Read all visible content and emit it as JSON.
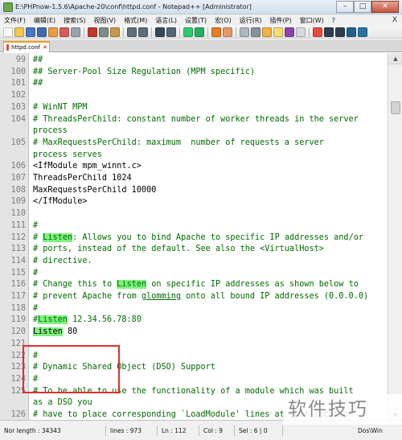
{
  "window": {
    "title": "E:\\PHPnow-1.5.6\\Apache-20\\conf\\httpd.conf - Notepad++ [Administrator]",
    "minimize": "–",
    "maximize": "□",
    "close": "✕"
  },
  "menu": {
    "items": [
      "文件(F)",
      "编辑(E)",
      "搜索(S)",
      "视图(V)",
      "格式(M)",
      "语言(L)",
      "设置(T)",
      "宏(O)",
      "运行(R)",
      "插件(P)",
      "窗口(W)",
      "?"
    ],
    "close_label": "X"
  },
  "tab": {
    "label": "httpd.conf",
    "close": "✕"
  },
  "lines": [
    {
      "n": "99",
      "t": "##"
    },
    {
      "n": "100",
      "t": "## Server-Pool Size Regulation (MPM specific)"
    },
    {
      "n": "101",
      "t": "##"
    },
    {
      "n": "102",
      "t": ""
    },
    {
      "n": "103",
      "t": "# WinNT MPM"
    },
    {
      "n": "104",
      "t": "# ThreadsPerChild: constant number of worker threads in the server"
    },
    {
      "n": "",
      "t": "process"
    },
    {
      "n": "105",
      "t": "# MaxRequestsPerChild: maximum  number of requests a server"
    },
    {
      "n": "",
      "t": "process serves"
    },
    {
      "n": "106",
      "t": "<IfModule mpm_winnt.c>"
    },
    {
      "n": "107",
      "t": "ThreadsPerChild 1024"
    },
    {
      "n": "108",
      "t": "MaxRequestsPerChild 10000"
    },
    {
      "n": "109",
      "t": "</IfModule>"
    },
    {
      "n": "110",
      "t": ""
    },
    {
      "n": "111",
      "t": "#"
    },
    {
      "n": "112",
      "t": "# Listen: Allows you to bind Apache to specific IP addresses and/or"
    },
    {
      "n": "113",
      "t": "# ports, instead of the default. See also the <VirtualHost>"
    },
    {
      "n": "114",
      "t": "# directive."
    },
    {
      "n": "115",
      "t": "#"
    },
    {
      "n": "116",
      "t": "# Change this to Listen on specific IP addresses as shown below to"
    },
    {
      "n": "117",
      "t": "# prevent Apache from glomming onto all bound IP addresses (0.0.0.0)"
    },
    {
      "n": "118",
      "t": "#"
    },
    {
      "n": "119",
      "t": "#Listen 12.34.56.78:80"
    },
    {
      "n": "120",
      "t": "Listen 80"
    },
    {
      "n": "121",
      "t": ""
    },
    {
      "n": "122",
      "t": "#"
    },
    {
      "n": "123",
      "t": "# Dynamic Shared Object (DSO) Support"
    },
    {
      "n": "124",
      "t": "#"
    },
    {
      "n": "125",
      "t": "# To be able to use the functionality of a module which was built"
    },
    {
      "n": "",
      "t": "as a DSO you"
    },
    {
      "n": "126",
      "t": "# have to place corresponding `LoadModule' lines at this location"
    }
  ],
  "highlight_word": "Listen",
  "highlight_color": "#7df27d",
  "comment_color": "#006a00",
  "annotation_color": "#e12f2f",
  "status": {
    "length": "Nor length : 34343",
    "lines": "lines : 973",
    "ln": "Ln : 112",
    "col": "Col : 9",
    "sel": "Sel : 6 | 0",
    "eol": "Dos\\Win"
  },
  "watermark": "软件技巧"
}
